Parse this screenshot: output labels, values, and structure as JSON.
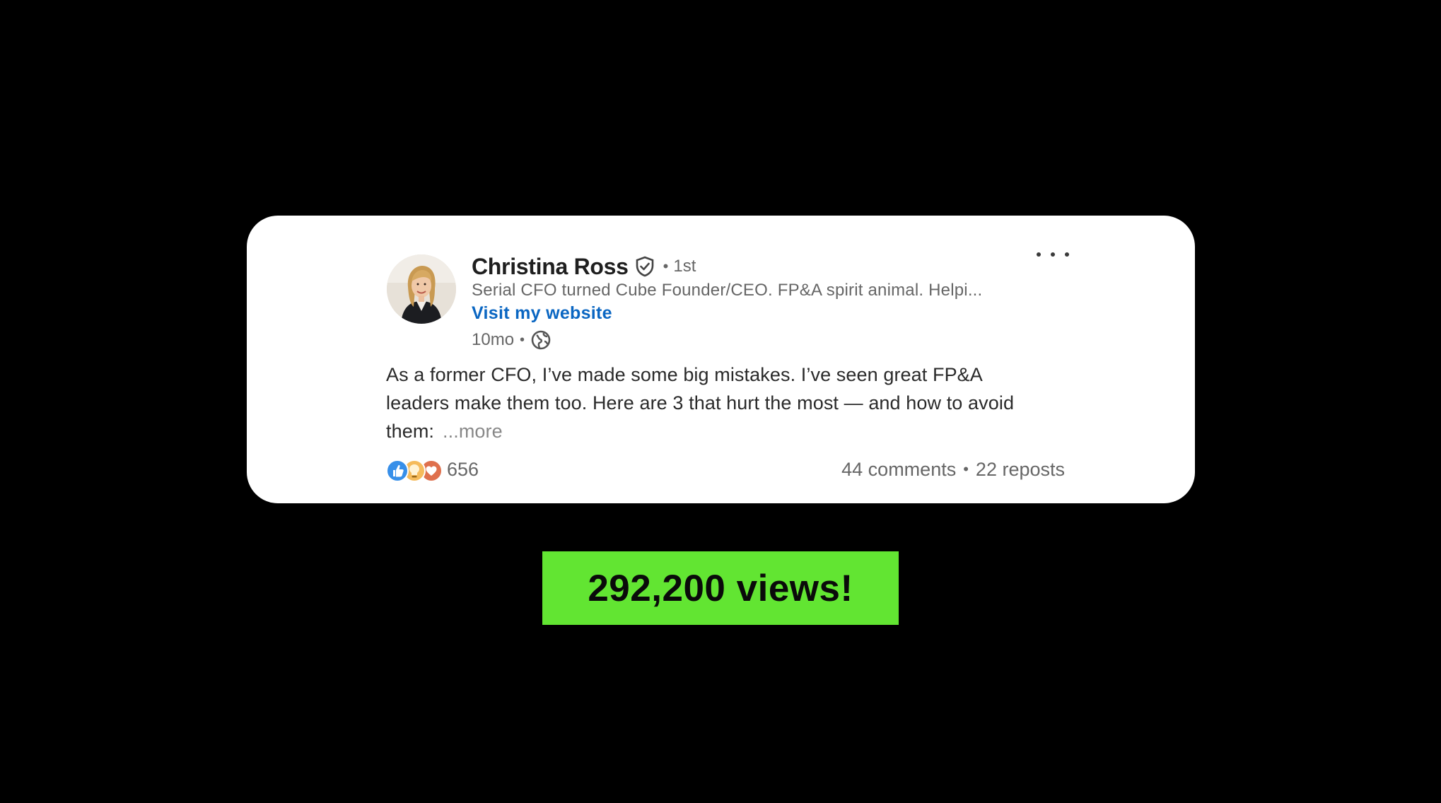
{
  "post": {
    "author": {
      "name": "Christina Ross",
      "connection": "1st",
      "headline": "Serial CFO turned Cube Founder/CEO. FP&A spirit animal. Helpi...",
      "website_link": "Visit my website",
      "verified_icon": "verified-shield-icon",
      "avatar": "profile-photo"
    },
    "meta": {
      "timestamp": "10mo",
      "visibility_icon": "globe-icon"
    },
    "body": {
      "lines": [
        "As a former CFO, I’ve made some big mistakes. I’ve seen great FP&A",
        "leaders make them too. Here are 3 that hurt the most — and how to avoid",
        "them:"
      ],
      "see_more": "...more"
    },
    "reactions": {
      "icons": [
        "like-icon",
        "insightful-icon",
        "love-icon"
      ],
      "count": "656"
    },
    "engagement": {
      "comments": "44 comments",
      "reposts": "22 reposts"
    },
    "menu_icon": "more-options-icon"
  },
  "views_badge": {
    "text": "292,200 views!",
    "color": "#62e532"
  },
  "colors": {
    "background": "#000000",
    "card": "#ffffff",
    "link_blue": "#0a66c2",
    "muted_text": "#666666"
  }
}
